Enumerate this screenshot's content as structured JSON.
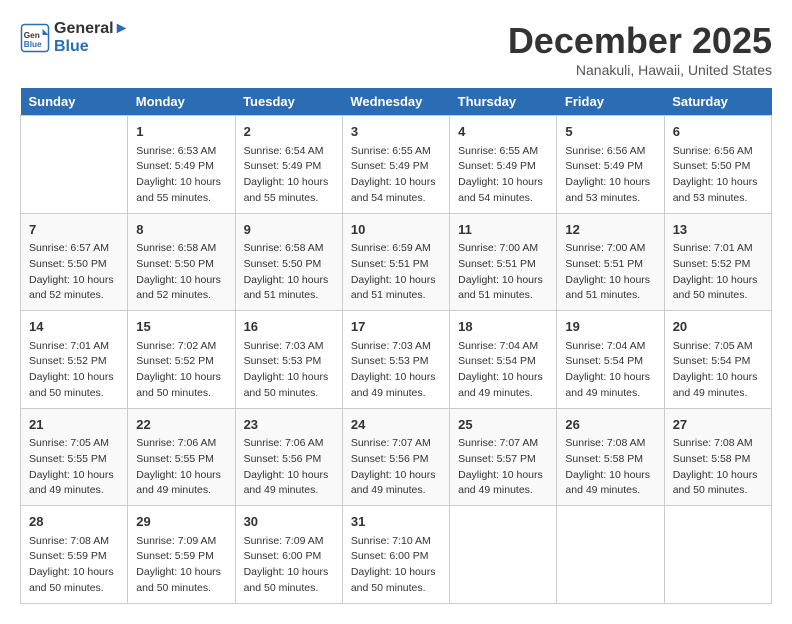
{
  "header": {
    "logo_line1": "General",
    "logo_line2": "Blue",
    "month": "December 2025",
    "location": "Nanakuli, Hawaii, United States"
  },
  "weekdays": [
    "Sunday",
    "Monday",
    "Tuesday",
    "Wednesday",
    "Thursday",
    "Friday",
    "Saturday"
  ],
  "weeks": [
    [
      {
        "day": "",
        "sunrise": "",
        "sunset": "",
        "daylight": ""
      },
      {
        "day": "1",
        "sunrise": "6:53 AM",
        "sunset": "5:49 PM",
        "daylight": "10 hours and 55 minutes."
      },
      {
        "day": "2",
        "sunrise": "6:54 AM",
        "sunset": "5:49 PM",
        "daylight": "10 hours and 55 minutes."
      },
      {
        "day": "3",
        "sunrise": "6:55 AM",
        "sunset": "5:49 PM",
        "daylight": "10 hours and 54 minutes."
      },
      {
        "day": "4",
        "sunrise": "6:55 AM",
        "sunset": "5:49 PM",
        "daylight": "10 hours and 54 minutes."
      },
      {
        "day": "5",
        "sunrise": "6:56 AM",
        "sunset": "5:49 PM",
        "daylight": "10 hours and 53 minutes."
      },
      {
        "day": "6",
        "sunrise": "6:56 AM",
        "sunset": "5:50 PM",
        "daylight": "10 hours and 53 minutes."
      }
    ],
    [
      {
        "day": "7",
        "sunrise": "6:57 AM",
        "sunset": "5:50 PM",
        "daylight": "10 hours and 52 minutes."
      },
      {
        "day": "8",
        "sunrise": "6:58 AM",
        "sunset": "5:50 PM",
        "daylight": "10 hours and 52 minutes."
      },
      {
        "day": "9",
        "sunrise": "6:58 AM",
        "sunset": "5:50 PM",
        "daylight": "10 hours and 51 minutes."
      },
      {
        "day": "10",
        "sunrise": "6:59 AM",
        "sunset": "5:51 PM",
        "daylight": "10 hours and 51 minutes."
      },
      {
        "day": "11",
        "sunrise": "7:00 AM",
        "sunset": "5:51 PM",
        "daylight": "10 hours and 51 minutes."
      },
      {
        "day": "12",
        "sunrise": "7:00 AM",
        "sunset": "5:51 PM",
        "daylight": "10 hours and 51 minutes."
      },
      {
        "day": "13",
        "sunrise": "7:01 AM",
        "sunset": "5:52 PM",
        "daylight": "10 hours and 50 minutes."
      }
    ],
    [
      {
        "day": "14",
        "sunrise": "7:01 AM",
        "sunset": "5:52 PM",
        "daylight": "10 hours and 50 minutes."
      },
      {
        "day": "15",
        "sunrise": "7:02 AM",
        "sunset": "5:52 PM",
        "daylight": "10 hours and 50 minutes."
      },
      {
        "day": "16",
        "sunrise": "7:03 AM",
        "sunset": "5:53 PM",
        "daylight": "10 hours and 50 minutes."
      },
      {
        "day": "17",
        "sunrise": "7:03 AM",
        "sunset": "5:53 PM",
        "daylight": "10 hours and 49 minutes."
      },
      {
        "day": "18",
        "sunrise": "7:04 AM",
        "sunset": "5:54 PM",
        "daylight": "10 hours and 49 minutes."
      },
      {
        "day": "19",
        "sunrise": "7:04 AM",
        "sunset": "5:54 PM",
        "daylight": "10 hours and 49 minutes."
      },
      {
        "day": "20",
        "sunrise": "7:05 AM",
        "sunset": "5:54 PM",
        "daylight": "10 hours and 49 minutes."
      }
    ],
    [
      {
        "day": "21",
        "sunrise": "7:05 AM",
        "sunset": "5:55 PM",
        "daylight": "10 hours and 49 minutes."
      },
      {
        "day": "22",
        "sunrise": "7:06 AM",
        "sunset": "5:55 PM",
        "daylight": "10 hours and 49 minutes."
      },
      {
        "day": "23",
        "sunrise": "7:06 AM",
        "sunset": "5:56 PM",
        "daylight": "10 hours and 49 minutes."
      },
      {
        "day": "24",
        "sunrise": "7:07 AM",
        "sunset": "5:56 PM",
        "daylight": "10 hours and 49 minutes."
      },
      {
        "day": "25",
        "sunrise": "7:07 AM",
        "sunset": "5:57 PM",
        "daylight": "10 hours and 49 minutes."
      },
      {
        "day": "26",
        "sunrise": "7:08 AM",
        "sunset": "5:58 PM",
        "daylight": "10 hours and 49 minutes."
      },
      {
        "day": "27",
        "sunrise": "7:08 AM",
        "sunset": "5:58 PM",
        "daylight": "10 hours and 50 minutes."
      }
    ],
    [
      {
        "day": "28",
        "sunrise": "7:08 AM",
        "sunset": "5:59 PM",
        "daylight": "10 hours and 50 minutes."
      },
      {
        "day": "29",
        "sunrise": "7:09 AM",
        "sunset": "5:59 PM",
        "daylight": "10 hours and 50 minutes."
      },
      {
        "day": "30",
        "sunrise": "7:09 AM",
        "sunset": "6:00 PM",
        "daylight": "10 hours and 50 minutes."
      },
      {
        "day": "31",
        "sunrise": "7:10 AM",
        "sunset": "6:00 PM",
        "daylight": "10 hours and 50 minutes."
      },
      {
        "day": "",
        "sunrise": "",
        "sunset": "",
        "daylight": ""
      },
      {
        "day": "",
        "sunrise": "",
        "sunset": "",
        "daylight": ""
      },
      {
        "day": "",
        "sunrise": "",
        "sunset": "",
        "daylight": ""
      }
    ]
  ]
}
